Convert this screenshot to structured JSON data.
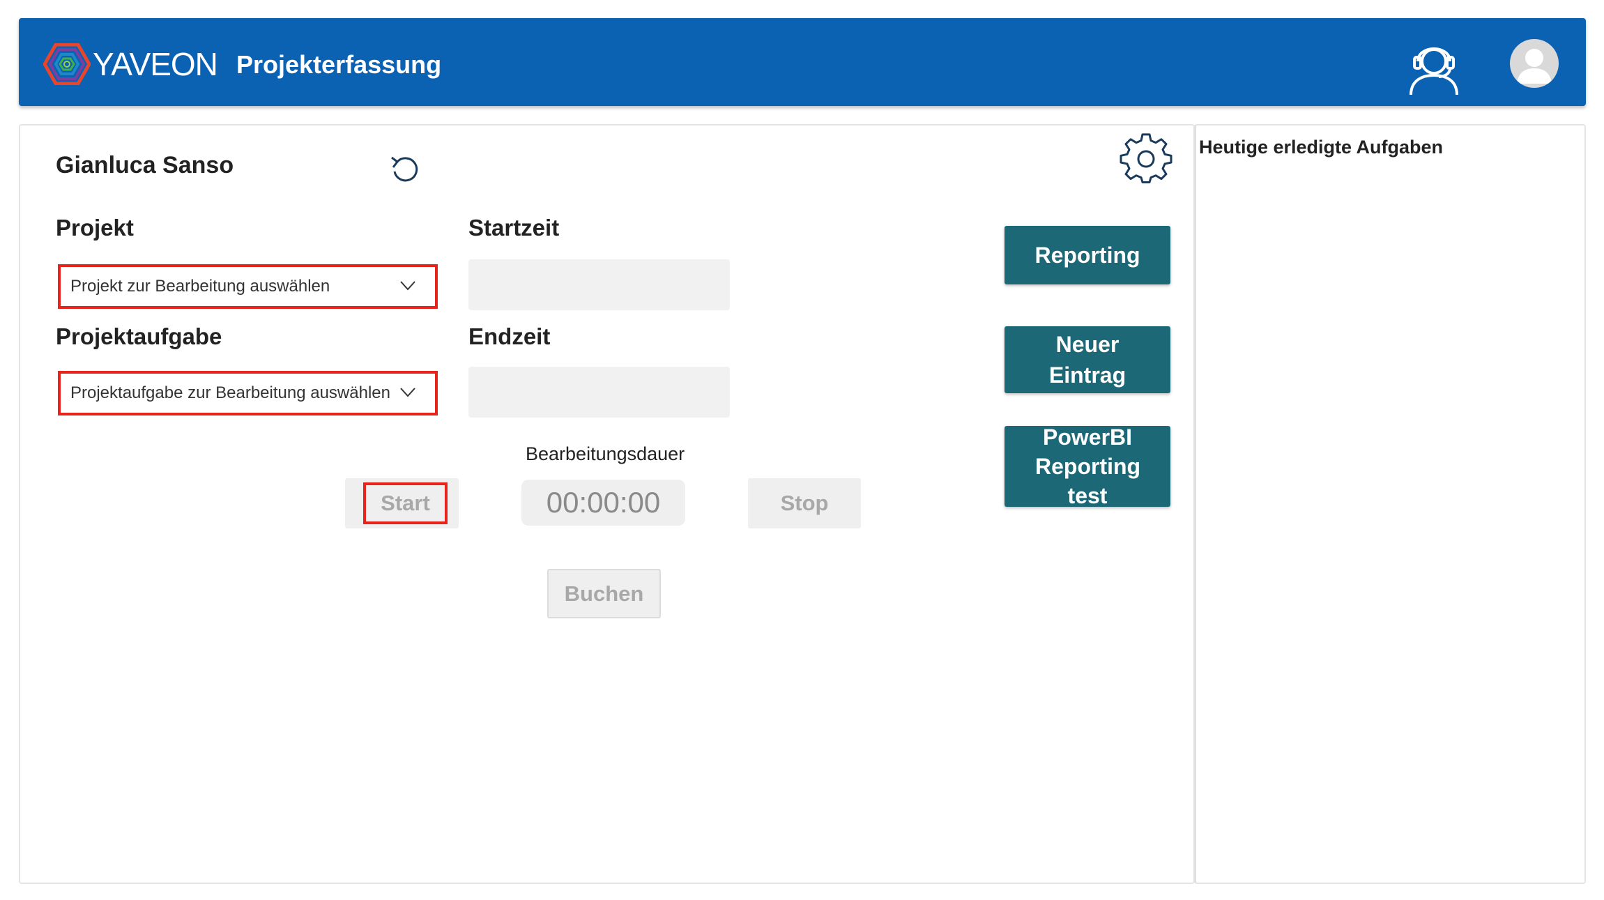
{
  "header": {
    "logo_text": "YAVEON",
    "app_title": "Projekterfassung",
    "support_icon": "headset-support-icon",
    "avatar_icon": "user-avatar-icon"
  },
  "main": {
    "user_name": "Gianluca Sanso",
    "reset_icon": "undo-icon",
    "settings_icon": "gear-icon",
    "projekt_label": "Projekt",
    "projekt_selected": "Projekt zur Bearbeitung auswählen",
    "aufgabe_label": "Projektaufgabe",
    "aufgabe_selected": "Projektaufgabe zur Bearbeitung auswählen",
    "startzeit_label": "Startzeit",
    "startzeit_value": "",
    "endzeit_label": "Endzeit",
    "endzeit_value": "",
    "duration_label": "Bearbeitungsdauer",
    "duration_value": "00:00:00",
    "start_button": "Start",
    "stop_button": "Stop",
    "buchen_button": "Buchen",
    "reporting_button": "Reporting",
    "neuer_eintrag_button": "Neuer Eintrag",
    "powerbi_button": "PowerBI Reporting test"
  },
  "side": {
    "title": "Heutige erledigte Aufgaben"
  },
  "colors": {
    "header_blue": "#0b62b3",
    "teal_button": "#1d6876",
    "highlight_red": "#e8231b",
    "disabled_grey": "#efefef"
  }
}
